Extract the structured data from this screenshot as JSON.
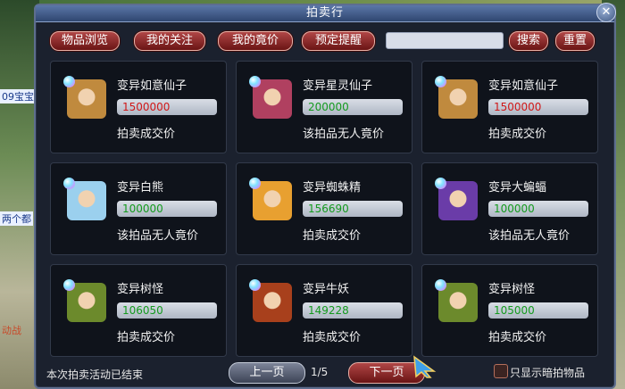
{
  "window": {
    "title": "拍卖行"
  },
  "toolbar": {
    "tabs": [
      "物品浏览",
      "我的关注",
      "我的竟价",
      "预定提醒"
    ],
    "search_value": "",
    "search_button": "搜索",
    "reset_button": "重置"
  },
  "background": {
    "label1": "09宝宝",
    "label2": "两个都",
    "label3": "动战"
  },
  "items": [
    {
      "name": "变异如意仙子",
      "price": "1500000",
      "status": "拍卖成交价",
      "price_color": "#d01818",
      "face": "#c08a3e"
    },
    {
      "name": "变异星灵仙子",
      "price": "200000",
      "status": "该拍品无人竟价",
      "price_color": "#149a1e",
      "face": "#b04060"
    },
    {
      "name": "变异如意仙子",
      "price": "1500000",
      "status": "拍卖成交价",
      "price_color": "#d01818",
      "face": "#c08a3e"
    },
    {
      "name": "变异白熊",
      "price": "100000",
      "status": "该拍品无人竟价",
      "price_color": "#149a1e",
      "face": "#9bd0ee"
    },
    {
      "name": "变异蜘蛛精",
      "price": "156690",
      "status": "拍卖成交价",
      "price_color": "#149a1e",
      "face": "#e8a030"
    },
    {
      "name": "变异大蝙蝠",
      "price": "100000",
      "status": "该拍品无人竟价",
      "price_color": "#149a1e",
      "face": "#6a3ca8"
    },
    {
      "name": "变异树怪",
      "price": "106050",
      "status": "拍卖成交价",
      "price_color": "#149a1e",
      "face": "#6c8a2c"
    },
    {
      "name": "变异牛妖",
      "price": "149228",
      "status": "拍卖成交价",
      "price_color": "#149a1e",
      "face": "#a8401c"
    },
    {
      "name": "变异树怪",
      "price": "105000",
      "status": "拍卖成交价",
      "price_color": "#149a1e",
      "face": "#6c8a2c"
    }
  ],
  "footer": {
    "status_text": "本次拍卖活动已结束",
    "prev_label": "上一页",
    "page_indicator": "1/5",
    "next_label": "下一页",
    "checkbox_label": "只显示暗拍物品",
    "checkbox_checked": false
  }
}
